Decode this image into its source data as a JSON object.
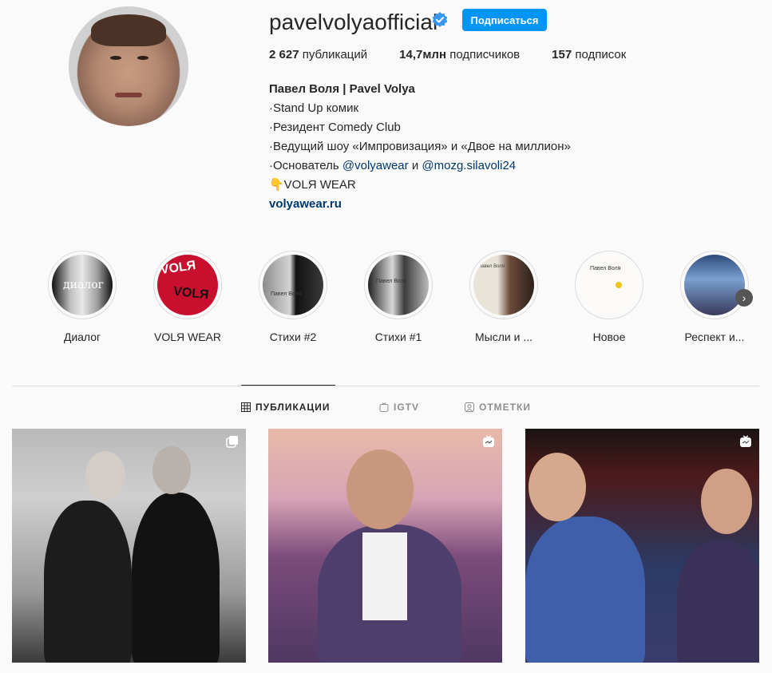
{
  "profile": {
    "username": "pavelvolyaofficial",
    "follow_label": "Подписаться",
    "stats": {
      "posts_count": "2 627",
      "posts_label": " публикаций",
      "followers_count": "14,7млн",
      "followers_label": " подписчиков",
      "following_count": "157",
      "following_label": " подписок"
    },
    "bio": {
      "name": "Павел Воля | Pavel Volya",
      "line1": "·Stand Up комик",
      "line2": "·Резидент Comedy Club",
      "line3": "·Ведущий шоу «Импровизация» и «Двое на миллион»",
      "line4_prefix": "·Основатель ",
      "line4_link1": "@volyawear",
      "line4_mid": " и ",
      "line4_link2": "@mozg.silavoli24",
      "line5": "👇VOLЯ WEAR",
      "website": "volyawear.ru"
    }
  },
  "highlights": [
    {
      "label": "Диалог"
    },
    {
      "label": "VOLЯ WEAR"
    },
    {
      "label": "Стихи #2"
    },
    {
      "label": "Стихи #1"
    },
    {
      "label": "Мысли и ..."
    },
    {
      "label": "Новое"
    },
    {
      "label": "Респект и..."
    }
  ],
  "highlight_art": {
    "dialog_text": "диалог",
    "volya_text": "VOLЯ",
    "poem_text": "Павел Воля"
  },
  "tabs": {
    "posts": "ПУБЛИКАЦИИ",
    "igtv": "IGTV",
    "tagged": "ОТМЕТКИ"
  },
  "colors": {
    "accent": "#0095f6",
    "link": "#00376b",
    "verified": "#3897f0"
  }
}
